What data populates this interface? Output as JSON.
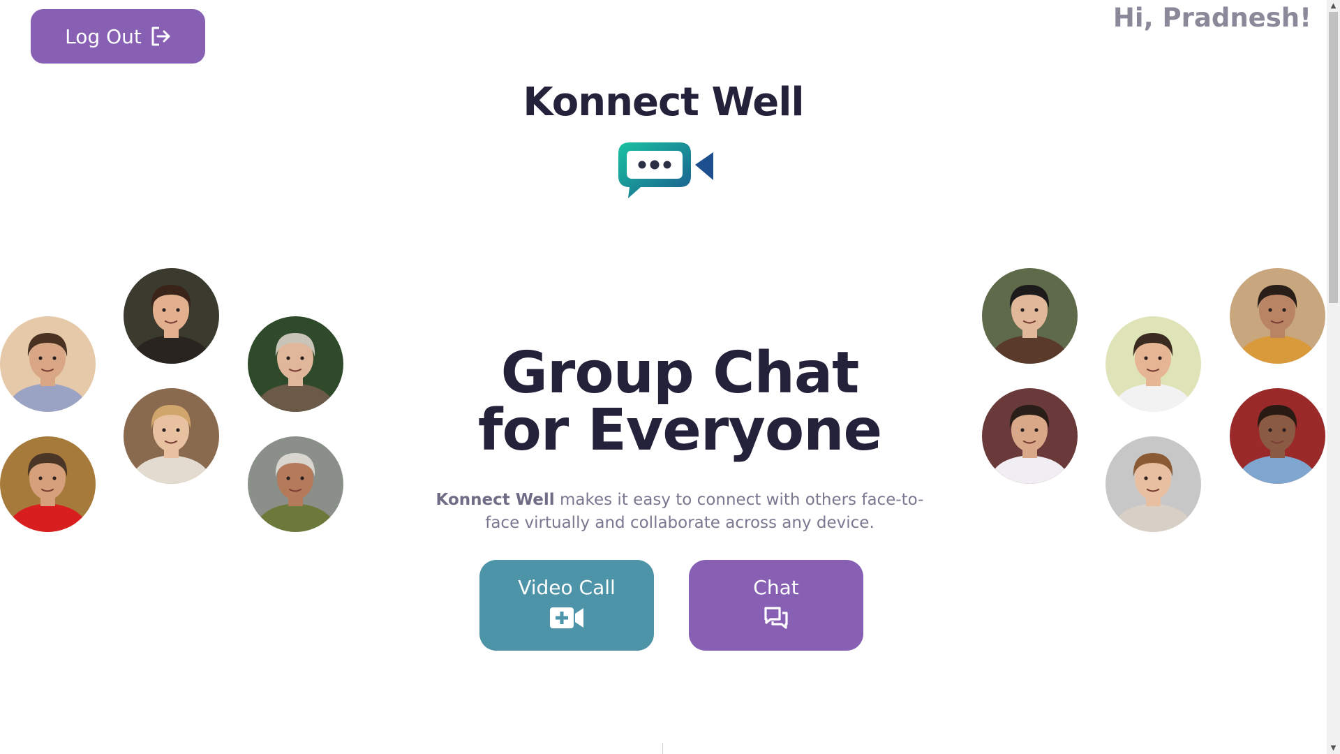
{
  "header": {
    "logout_label": "Log Out",
    "greeting": "Hi, Pradnesh!"
  },
  "brand": {
    "name": "Konnect Well"
  },
  "hero": {
    "title_line1": "Group Chat",
    "title_line2": "for Everyone",
    "description_brand": "Konnect Well",
    "description_rest": " makes it easy to connect with others face-to-face virtually and collaborate across any device."
  },
  "actions": {
    "video_call_label": "Video Call",
    "chat_label": "Chat"
  },
  "icons": {
    "logout": "logout-icon",
    "logo": "chat-bubble-video-logo",
    "video": "video-plus-icon",
    "chat": "chat-bubbles-icon"
  },
  "colors": {
    "primary_purple": "#875fb3",
    "teal": "#4d94a8",
    "heading": "#23223a",
    "muted": "#8a8899",
    "logo_teal": "#16b3a0",
    "logo_blue": "#1d4f8f"
  },
  "avatars_left": [
    {
      "id": "left-1",
      "bg": "#e6c9a8",
      "skin": "#d9a785",
      "hair": "#4a3222",
      "shirt": "#9aa3c4"
    },
    {
      "id": "left-2",
      "bg": "#3b3a2e",
      "skin": "#e2b08e",
      "hair": "#3a2419",
      "shirt": "#2a2420"
    },
    {
      "id": "left-3",
      "bg": "#2f4a2a",
      "skin": "#e0b79a",
      "hair": "#c9c4b8",
      "shirt": "#6b5a48"
    },
    {
      "id": "left-4",
      "bg": "#8a6a4e",
      "skin": "#e8c1a0",
      "hair": "#d1a66c",
      "shirt": "#e4dbd0"
    },
    {
      "id": "left-5",
      "bg": "#a67a3a",
      "skin": "#d6a07c",
      "hair": "#4a3526",
      "shirt": "#d81e1e"
    },
    {
      "id": "left-6",
      "bg": "#8a8f8a",
      "skin": "#b57a5a",
      "hair": "#d9d6d0",
      "shirt": "#6b7a3a"
    }
  ],
  "avatars_right": [
    {
      "id": "right-1",
      "bg": "#5e6a4a",
      "skin": "#e2b89a",
      "hair": "#1c1a1a",
      "shirt": "#5a3a2a"
    },
    {
      "id": "right-2",
      "bg": "#dfe3b8",
      "skin": "#e6b594",
      "hair": "#3a2a20",
      "shirt": "#f2f2f2"
    },
    {
      "id": "right-3",
      "bg": "#c8a67e",
      "skin": "#b98464",
      "hair": "#2a1e18",
      "shirt": "#d99a3c"
    },
    {
      "id": "right-4",
      "bg": "#6a3a3a",
      "skin": "#d9a888",
      "hair": "#2a1e18",
      "shirt": "#f0eef2"
    },
    {
      "id": "right-5",
      "bg": "#c7c7c7",
      "skin": "#e8bfa0",
      "hair": "#8a5a34",
      "shirt": "#d8d0c6"
    },
    {
      "id": "right-6",
      "bg": "#9a2a2a",
      "skin": "#8a5a42",
      "hair": "#2a1a14",
      "shirt": "#7fa6cf"
    }
  ]
}
